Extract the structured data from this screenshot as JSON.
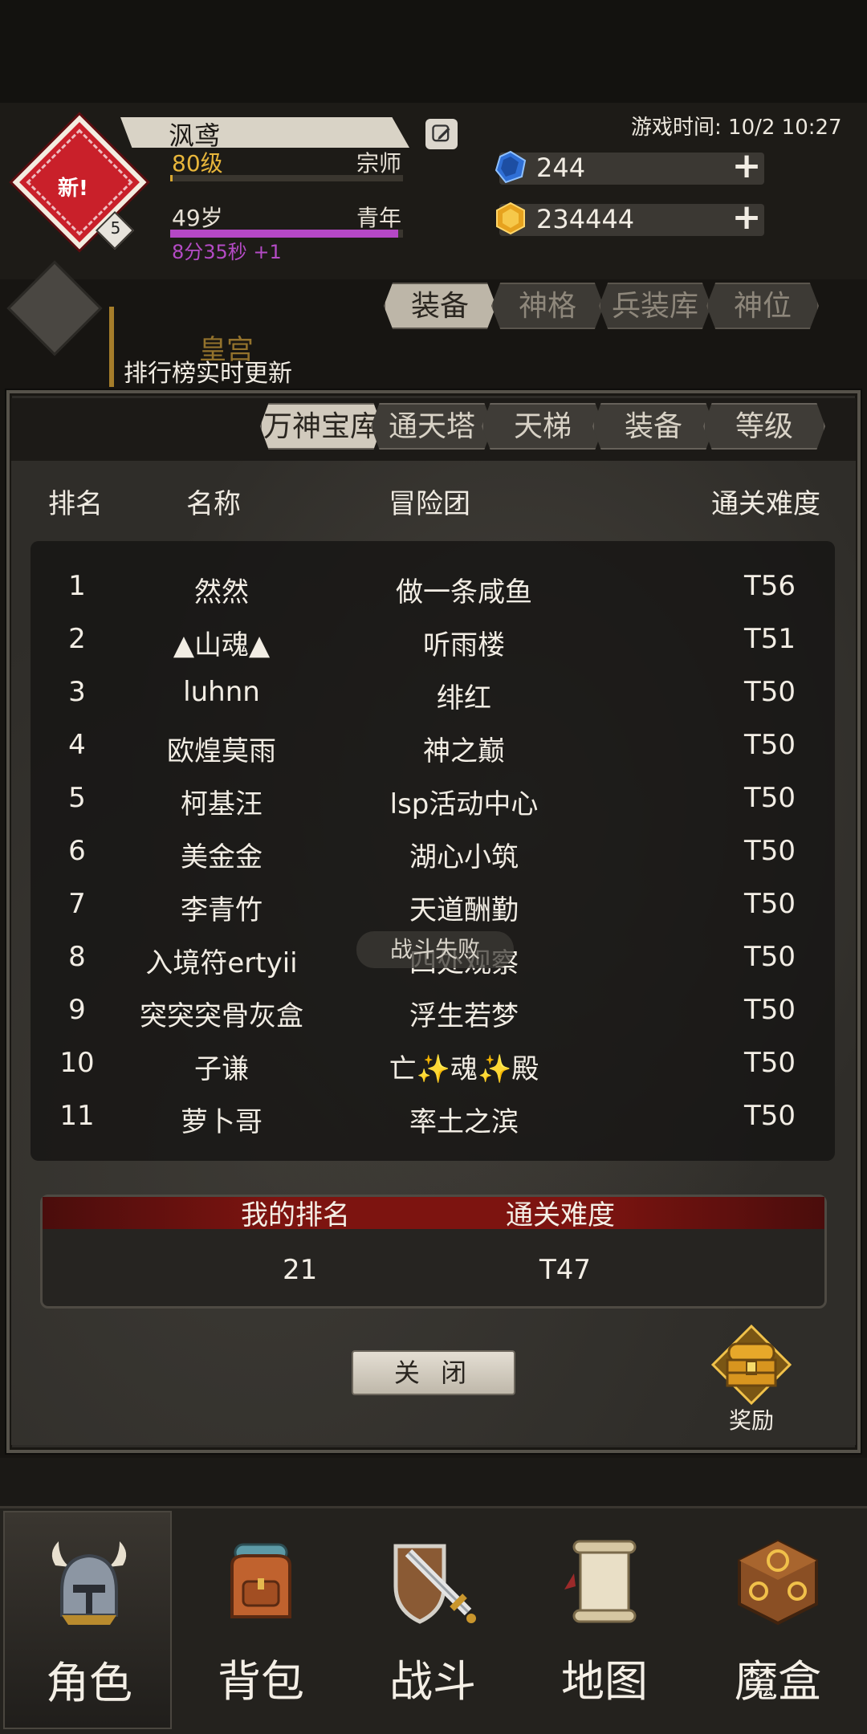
{
  "header": {
    "player_name": "沨鸢",
    "avatar_new_label": "新!",
    "avatar_badge": "5",
    "level": "80级",
    "rank_title": "宗师",
    "age": "49岁",
    "age_stage": "青年",
    "timer": "8分35秒 +1",
    "game_time": "游戏时间: 10/2 10:27",
    "gem_blue": "244",
    "gem_gold": "234444",
    "age_progress": 0.98,
    "level_progress": 0.01
  },
  "background_tabs": [
    "装备",
    "神格",
    "兵装库",
    "神位"
  ],
  "background_text": {
    "gold_label": "皇宫",
    "live_update": "排行榜实时更新"
  },
  "ranking": {
    "tabs": [
      "万神宝库",
      "通天塔",
      "天梯",
      "装备",
      "等级"
    ],
    "active_tab": 0,
    "columns": {
      "rank": "排名",
      "name": "名称",
      "guild": "冒险团",
      "difficulty": "通关难度"
    },
    "rows": [
      {
        "rank": "1",
        "name": "然然",
        "guild": "做一条咸鱼",
        "difficulty": "T56"
      },
      {
        "rank": "2",
        "name": "▲山魂▲",
        "guild": "听雨楼",
        "difficulty": "T51"
      },
      {
        "rank": "3",
        "name": "luhnn",
        "guild": "绯红",
        "difficulty": "T50"
      },
      {
        "rank": "4",
        "name": "欧煌莫雨",
        "guild": "神之巅",
        "difficulty": "T50"
      },
      {
        "rank": "5",
        "name": "柯基汪",
        "guild": "lsp活动中心",
        "difficulty": "T50"
      },
      {
        "rank": "6",
        "name": "美金金",
        "guild": "湖心小筑",
        "difficulty": "T50"
      },
      {
        "rank": "7",
        "name": "李青竹",
        "guild": "天道酬勤",
        "difficulty": "T50"
      },
      {
        "rank": "8",
        "name": "入境符ertyii",
        "guild": "四处观察",
        "difficulty": "T50"
      },
      {
        "rank": "9",
        "name": "突突突骨灰盒",
        "guild": "浮生若梦",
        "difficulty": "T50"
      },
      {
        "rank": "10",
        "name": "子谦",
        "guild": "亡✨魂✨殿",
        "difficulty": "T50"
      },
      {
        "rank": "11",
        "name": "萝卜哥",
        "guild": "率土之滨",
        "difficulty": "T50"
      }
    ],
    "toast": "战斗失败",
    "my_rank_label": "我的排名",
    "my_difficulty_label": "通关难度",
    "my_rank": "21",
    "my_difficulty": "T47",
    "close_label": "关 闭",
    "reward_label": "奖励"
  },
  "bottom_nav": [
    {
      "label": "角色",
      "icon": "helmet-icon"
    },
    {
      "label": "背包",
      "icon": "backpack-icon"
    },
    {
      "label": "战斗",
      "icon": "sword-shield-icon"
    },
    {
      "label": "地图",
      "icon": "scroll-map-icon"
    },
    {
      "label": "魔盒",
      "icon": "magic-box-icon"
    }
  ],
  "colors": {
    "accent_gold": "#e8b63b",
    "age_bar": "#b548c6",
    "my_rank_header": "#7d1410"
  }
}
